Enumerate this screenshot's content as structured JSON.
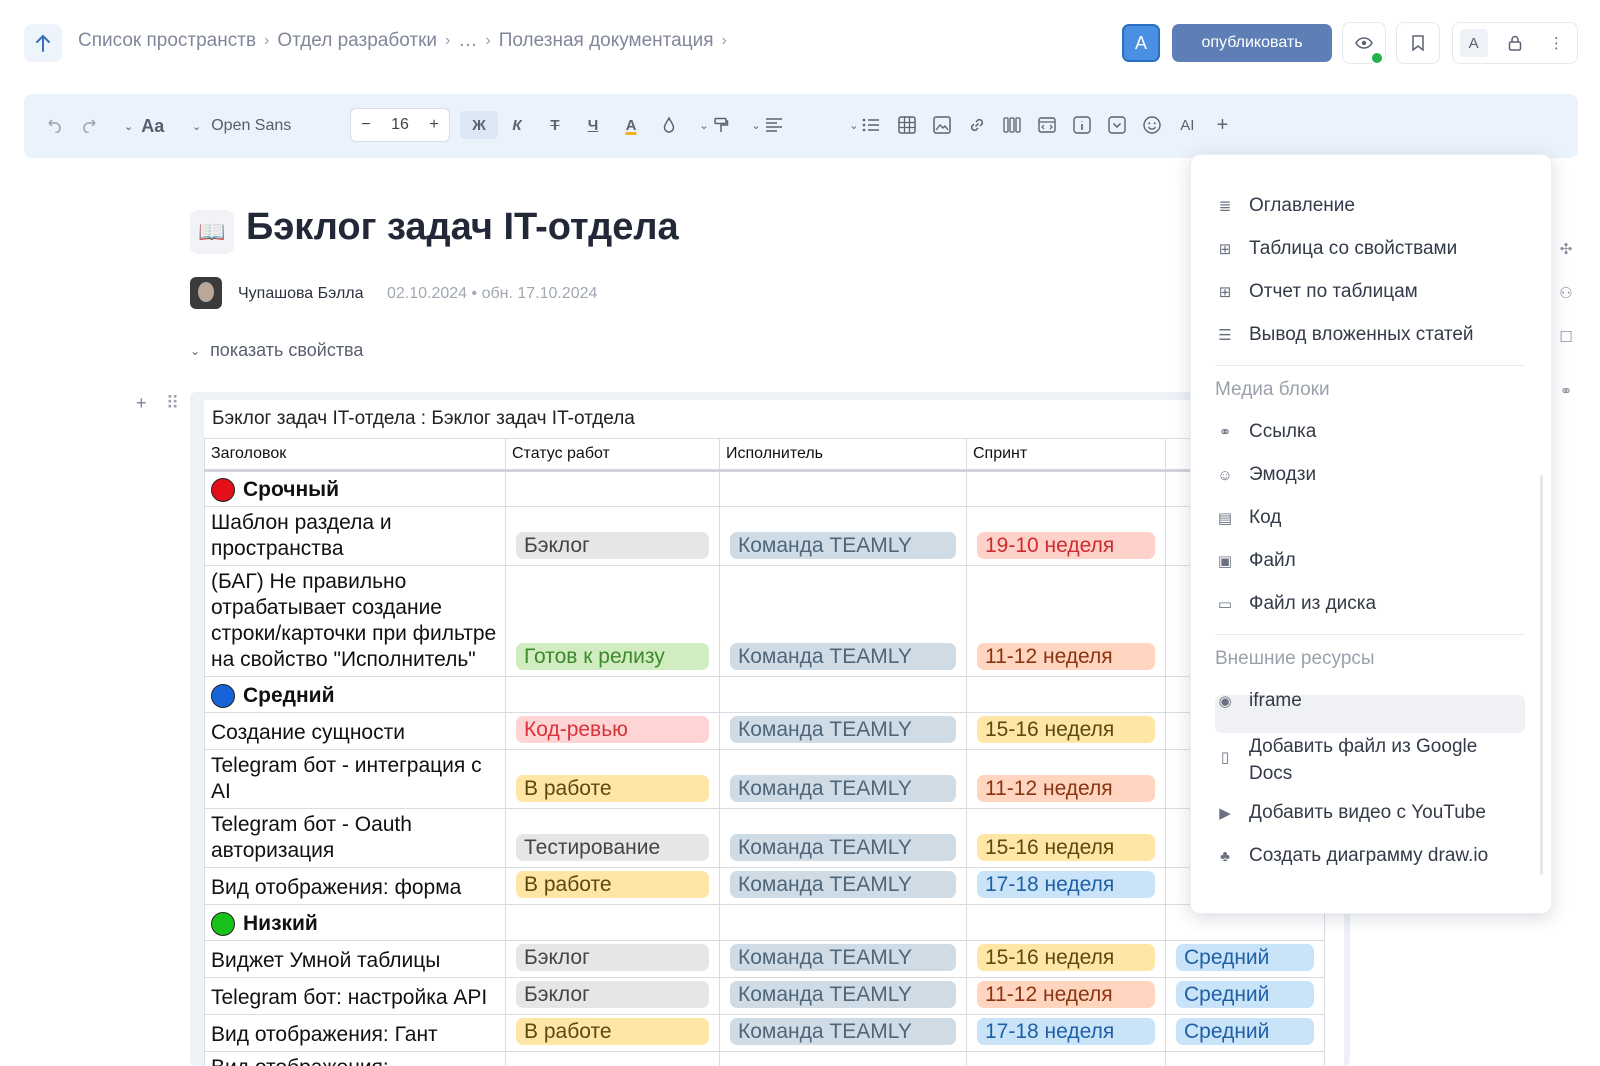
{
  "breadcrumbs": [
    "Список пространств",
    "Отдел разработки",
    "…",
    "Полезная документация"
  ],
  "header": {
    "avatar_letter": "A",
    "publish_label": "опубликовать",
    "right_letter": "A"
  },
  "toolbar": {
    "font_family": "Open Sans",
    "font_size": "16",
    "text_style_label": "Aa",
    "bold": "Ж",
    "italic": "К",
    "strike": "Т",
    "underline": "Ч",
    "color": "A",
    "ai_label": "AI"
  },
  "document": {
    "emoji": "📖",
    "title": "Бэклог задач IT-отдела",
    "author": "Чупашова Бэлла",
    "dates": "02.10.2024 • обн. 17.10.2024",
    "show_properties": "показать свойства"
  },
  "table": {
    "title": "Бэклог задач IT-отдела : Бэклог задач IT-отдела",
    "columns": [
      "Заголовок",
      "Статус работ",
      "Исполнитель",
      "Спринт",
      ""
    ],
    "groups": [
      {
        "label": "Срочный",
        "color": "#e3101a",
        "rows": [
          {
            "title": "Шаблон раздела и пространства",
            "status": "Бэклог",
            "status_color": "gray",
            "assignee": "Команда TEAMLY",
            "sprint": "19-10 неделя",
            "sprint_color": "red",
            "priority": ""
          },
          {
            "title": "(БАГ) Не правильно отрабатывает создание строки/карточки при фильтре на свойство \"Исполнитель\"",
            "status": "Готов к релизу",
            "status_color": "green",
            "assignee": "Команда TEAMLY",
            "sprint": "11-12 неделя",
            "sprint_color": "orange",
            "priority": ""
          }
        ]
      },
      {
        "label": "Средний",
        "color": "#1565d8",
        "rows": [
          {
            "title": "Создание сущности",
            "status": "Код-ревью",
            "status_color": "pink",
            "assignee": "Команда TEAMLY",
            "sprint": "15-16 неделя",
            "sprint_color": "yellow",
            "priority": ""
          },
          {
            "title": "Telegram бот - интеграция с AI",
            "status": "В работе",
            "status_color": "yellow",
            "assignee": "Команда TEAMLY",
            "sprint": "11-12 неделя",
            "sprint_color": "orange",
            "priority": ""
          },
          {
            "title": "Telegram бот - Oauth авторизация",
            "status": "Тестирование",
            "status_color": "gray",
            "assignee": "Команда TEAMLY",
            "sprint": "15-16 неделя",
            "sprint_color": "yellow",
            "priority": ""
          },
          {
            "title": "Вид отображения: форма",
            "status": "В работе",
            "status_color": "yellow",
            "assignee": "Команда TEAMLY",
            "sprint": "17-18 неделя",
            "sprint_color": "blue",
            "priority": ""
          }
        ]
      },
      {
        "label": "Низкий",
        "color": "#18c21a",
        "rows": [
          {
            "title": "Виджет Умной таблицы",
            "status": "Бэклог",
            "status_color": "gray",
            "assignee": "Команда TEAMLY",
            "sprint": "15-16 неделя",
            "sprint_color": "yellow",
            "priority": "Средний"
          },
          {
            "title": "Telegram бот: настройка API",
            "status": "Бэклог",
            "status_color": "gray",
            "assignee": "Команда TEAMLY",
            "sprint": "11-12 неделя",
            "sprint_color": "orange",
            "priority": "Средний"
          },
          {
            "title": "Вид отображения: Гант",
            "status": "В работе",
            "status_color": "yellow",
            "assignee": "Команда TEAMLY",
            "sprint": "17-18 неделя",
            "sprint_color": "blue",
            "priority": "Средний"
          },
          {
            "title": "Вид отображения:",
            "status": "",
            "status_color": "",
            "assignee": "",
            "sprint": "",
            "sprint_color": "",
            "priority": ""
          }
        ]
      }
    ]
  },
  "menu": {
    "items_top": [
      "Оглавление",
      "Таблица со свойствами",
      "Отчет по таблицам",
      "Вывод вложенных статей"
    ],
    "media_section": "Медиа блоки",
    "media_items": [
      "Ссылка",
      "Эмодзи",
      "Код",
      "Файл",
      "Файл из диска"
    ],
    "external_section": "Внешние ресурсы",
    "external_items": [
      "iframe",
      "Добавить файл из Google Docs",
      "Добавить видео с YouTube",
      "Создать диаграмму draw.io"
    ],
    "highlighted": "iframe"
  }
}
